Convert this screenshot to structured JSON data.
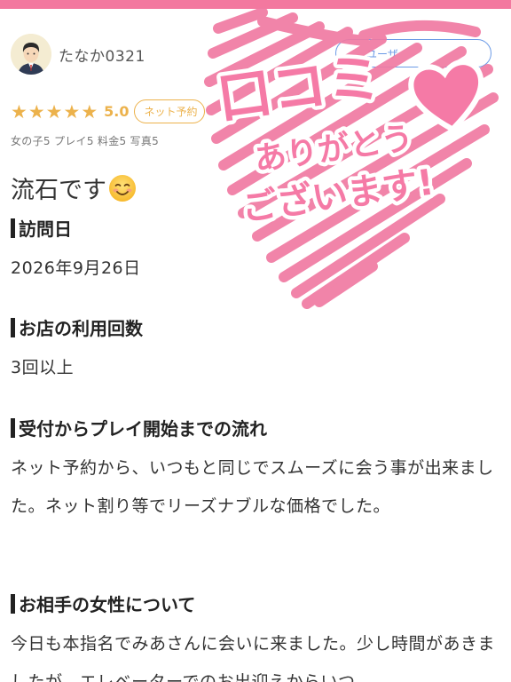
{
  "reviewer": {
    "username": "たなか0321",
    "user_button_label": "ユーザ"
  },
  "rating": {
    "stars": 5,
    "score": "5.0",
    "badge_label": "ネット予約"
  },
  "subscores": "女の子5 プレイ5 料金5 写真5",
  "review": {
    "title": "流石です"
  },
  "sections": [
    {
      "heading": "訪問日",
      "text": "2026年9月26日"
    },
    {
      "heading": "お店の利用回数",
      "text": "3回以上"
    },
    {
      "heading": "受付からプレイ開始までの流れ",
      "text": "ネット予約から、いつもと同じでスムーズに会う事が出来ました。ネット割り等でリーズナブルな価格でした。"
    },
    {
      "heading": "お相手の女性について",
      "text": "今日も本指名でみあさんに会いに来ました。少し時間があきましたが、エレベーターでのお出迎えからいつ"
    }
  ],
  "overlay": {
    "line1": "口コミ",
    "line2": "ありがとう",
    "line3": "ございます!"
  },
  "colors": {
    "accent_pink": "#f3789f",
    "star_gold": "#ecb24c",
    "button_blue": "#6b9ae6"
  }
}
